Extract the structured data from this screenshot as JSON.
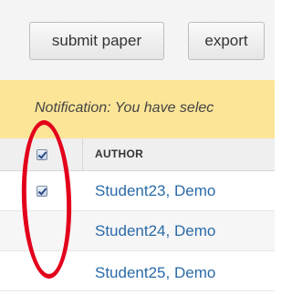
{
  "toolbar": {
    "submit_label": "submit paper",
    "export_label": "export"
  },
  "notification": {
    "text": "Notification: You have selec"
  },
  "table": {
    "columns": [
      "AUTHOR"
    ],
    "rows": [
      {
        "author": "Student23, Demo",
        "checked": true
      },
      {
        "author": "Student24, Demo",
        "checked": false
      },
      {
        "author": "Student25, Demo",
        "checked": false
      }
    ],
    "select_all_checked": true
  },
  "colors": {
    "notification_bg": "#fce597",
    "link": "#2a6aa8",
    "annotation": "#e3001b"
  }
}
